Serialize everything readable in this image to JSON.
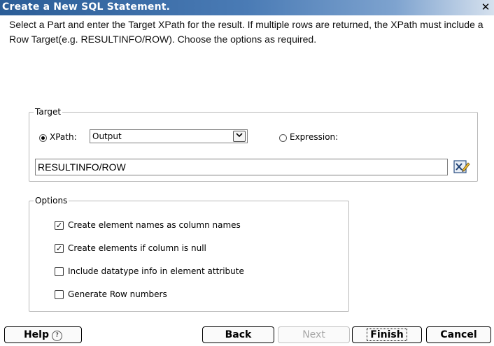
{
  "window": {
    "title": "Create a New SQL Statement.",
    "close_glyph": "✕",
    "instructions": "Select a Part and enter the Target XPath for the result. If multiple rows are returned, the XPath must include a Row Target(e.g. RESULTINFO/ROW). Choose the options as required."
  },
  "target": {
    "legend": "Target",
    "xpath_radio_label": "XPath:",
    "xpath_selected": true,
    "part_value": "Output",
    "expression_radio_label": "Expression:",
    "expression_selected": false,
    "xpath_value": "RESULTINFO/ROW",
    "edit_icon": "xpath-editor-icon"
  },
  "options": {
    "legend": "Options",
    "items": [
      {
        "label": "Create element names as column names",
        "checked": true
      },
      {
        "label": "Create elements if column is null",
        "checked": true
      },
      {
        "label": "Include datatype info in element attribute",
        "checked": false
      },
      {
        "label": "Generate Row numbers",
        "checked": false
      }
    ]
  },
  "buttons": {
    "help": "Help",
    "back": "Back",
    "next": "Next",
    "finish": "Finish",
    "cancel": "Cancel"
  }
}
